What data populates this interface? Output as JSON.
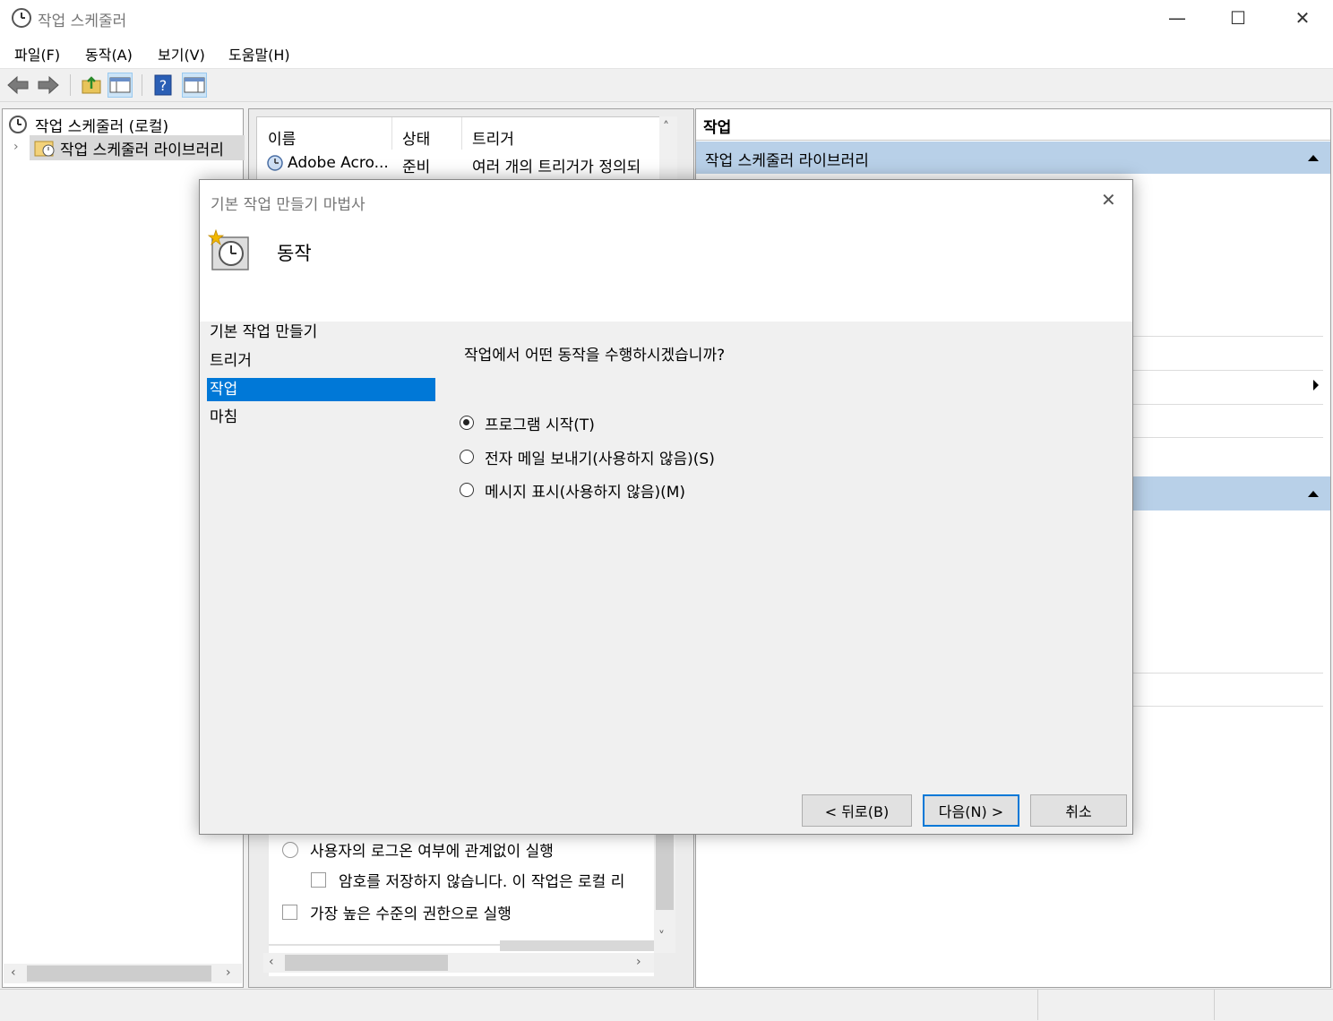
{
  "window": {
    "title": "작업 스케줄러",
    "icon": "clock-icon"
  },
  "window_controls": {
    "minimize": "—",
    "maximize": "☐",
    "close": "✕"
  },
  "menubar": {
    "items": [
      "파일(F)",
      "동작(A)",
      "보기(V)",
      "도움말(H)"
    ]
  },
  "toolbar": {
    "icons": [
      "back-arrow-icon",
      "forward-arrow-icon",
      "folder-up-icon",
      "show-hide-console-tree-icon",
      "help-icon",
      "show-hide-action-pane-icon"
    ]
  },
  "tree": {
    "root": "작업 스케줄러 (로컬)",
    "child": "작업 스케줄러 라이브러리"
  },
  "task_list": {
    "columns": [
      "이름",
      "상태",
      "트리거"
    ],
    "rows": [
      {
        "name": "Adobe Acro...",
        "status": "준비",
        "trigger": "여러 개의 트리거가 정의되"
      }
    ]
  },
  "task_properties": {
    "option_run_regardless": "사용자의 로그온 여부에 관계없이 실행",
    "option_no_password": "암호를 저장하지 않습니다. 이 작업은 로컬 리",
    "option_highest": "가장 높은 수준의 권한으로 실행"
  },
  "actions_pane": {
    "header": "작업",
    "section": "작업 스케줄러 라이브러리"
  },
  "wizard": {
    "title": "기본 작업 만들기 마법사",
    "heading": "동작",
    "steps": [
      "기본 작업 만들기",
      "트리거",
      "작업",
      "마침"
    ],
    "selected_step": 2,
    "question": "작업에서 어떤 동작을 수행하시겠습니까?",
    "options": [
      "프로그램 시작(T)",
      "전자 메일 보내기(사용하지 않음)(S)",
      "메시지 표시(사용하지 않음)(M)"
    ],
    "selected_option": 0,
    "buttons": {
      "back": "< 뒤로(B)",
      "next": "다음(N) >",
      "cancel": "취소"
    },
    "close_glyph": "✕"
  },
  "colors": {
    "accent": "#0078d7",
    "band": "#b8d0e8"
  }
}
